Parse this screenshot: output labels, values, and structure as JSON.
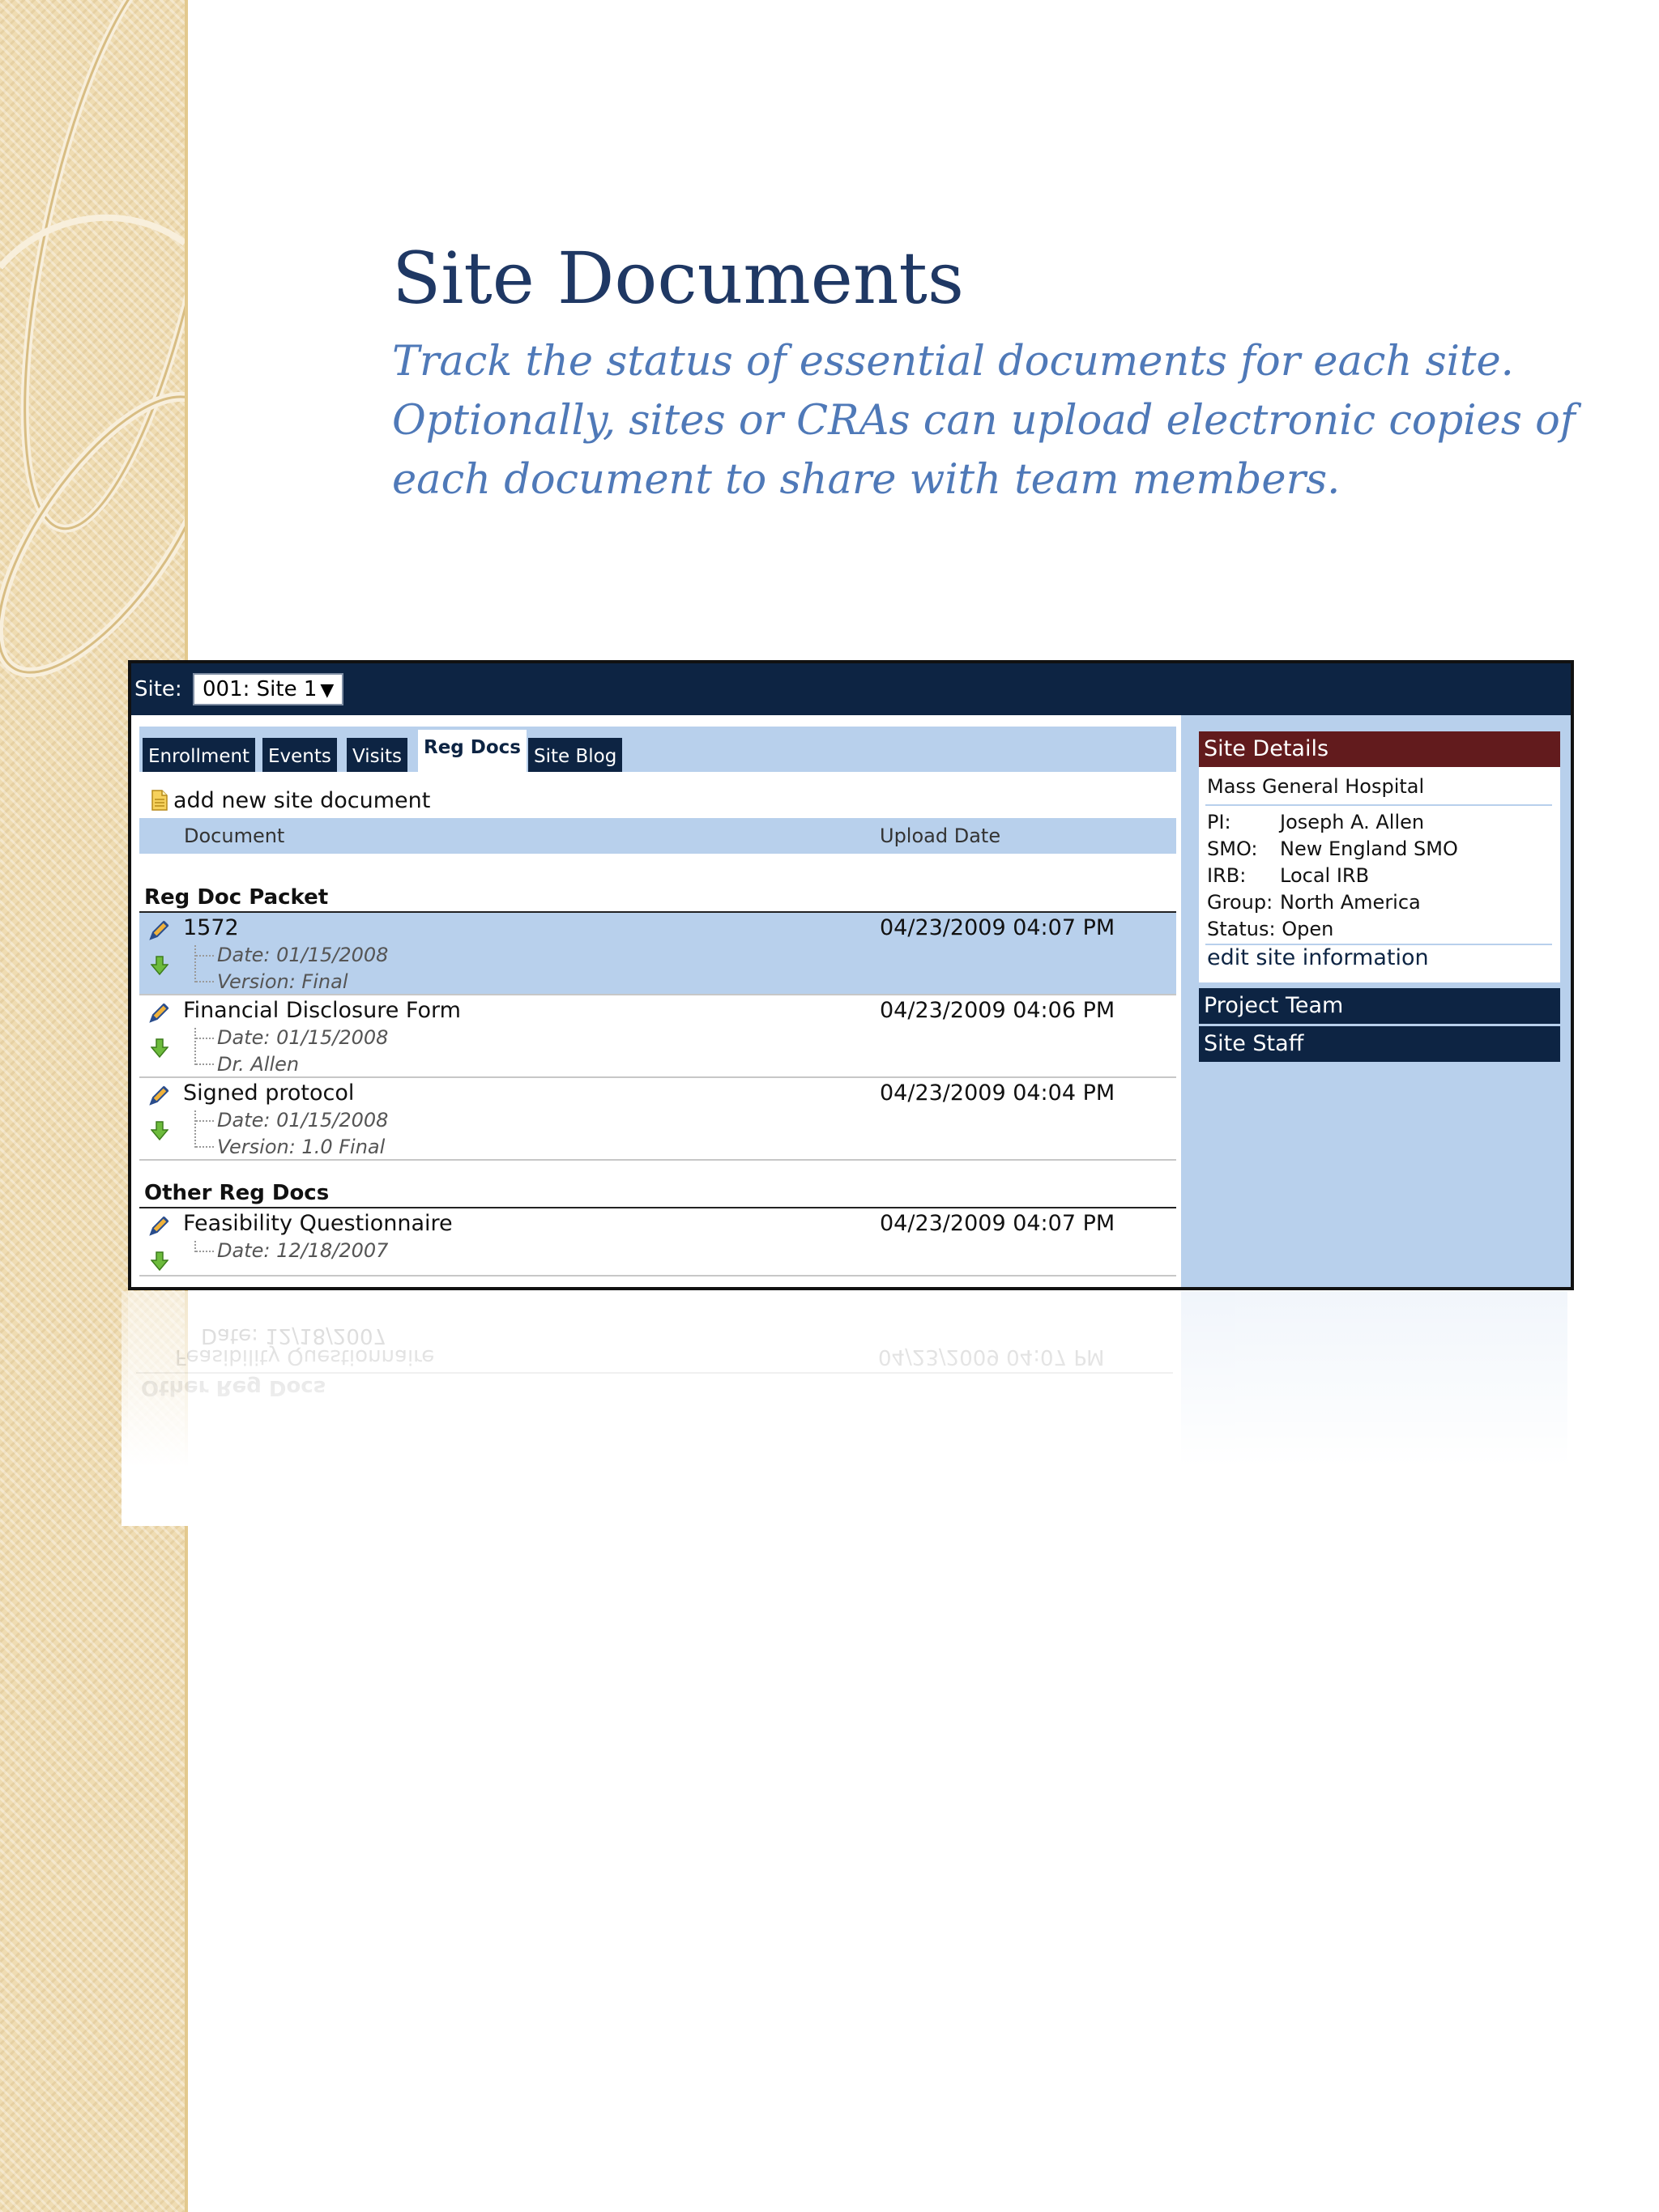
{
  "slide": {
    "title": "Site Documents",
    "subtitle": "Track the status of essential documents for each site. Optionally, sites or CRAs can upload electronic copies of each document to share with team members."
  },
  "app": {
    "site_label": "Site:",
    "site_selected": "001: Site 1",
    "tabs": [
      "Enrollment",
      "Events",
      "Visits",
      "Reg Docs",
      "Site Blog"
    ],
    "active_tab": "Reg Docs",
    "add_document": "add new site document",
    "columns": {
      "document": "Document",
      "upload_date": "Upload Date"
    },
    "groups": [
      {
        "name": "Reg Doc Packet",
        "docs": [
          {
            "title": "1572",
            "upload_date": "04/23/2009 04:07 PM",
            "meta": [
              "Date: 01/15/2008",
              "Version: Final"
            ],
            "selected": true
          },
          {
            "title": "Financial Disclosure Form",
            "upload_date": "04/23/2009 04:06 PM",
            "meta": [
              "Date: 01/15/2008",
              "Dr. Allen"
            ]
          },
          {
            "title": "Signed protocol",
            "upload_date": "04/23/2009 04:04 PM",
            "meta": [
              "Date: 01/15/2008",
              "Version: 1.0 Final"
            ]
          }
        ]
      },
      {
        "name": "Other Reg Docs",
        "docs": [
          {
            "title": "Feasibility Questionnaire",
            "upload_date": "04/23/2009 04:07 PM",
            "meta": [
              "Date: 12/18/2007"
            ]
          }
        ]
      }
    ],
    "sidebar": {
      "details_title": "Site Details",
      "hospital": "Mass General Hospital",
      "fields": [
        {
          "label": "PI:",
          "value": "Joseph A. Allen"
        },
        {
          "label": "SMO:",
          "value": "New England SMO"
        },
        {
          "label": "IRB:",
          "value": "Local IRB"
        },
        {
          "label": "Group:",
          "value": "North America"
        },
        {
          "label": "Status:",
          "value": "Open"
        }
      ],
      "edit_link": "edit site information",
      "project_team": "Project Team",
      "site_staff": "Site Staff"
    }
  },
  "colors": {
    "navy": "#0d2443",
    "light_blue": "#b8d0ec",
    "maroon": "#621b1d",
    "title_blue": "#1f3864",
    "subtitle_blue": "#4f79b8"
  }
}
